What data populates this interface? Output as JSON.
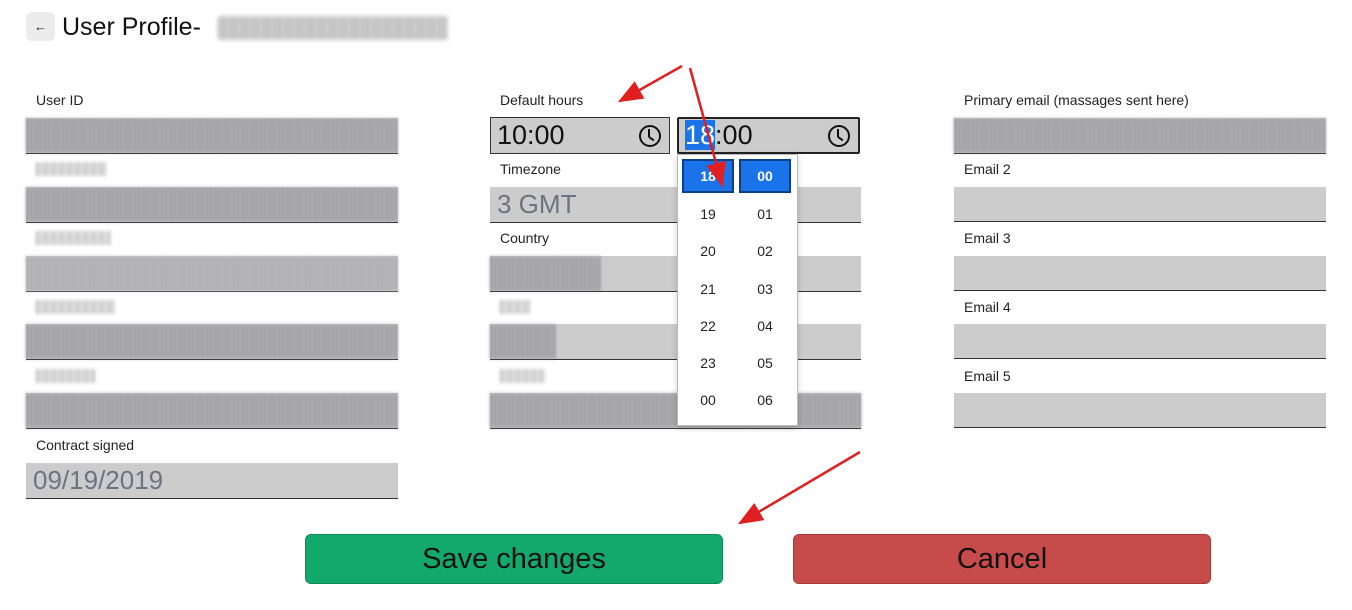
{
  "header": {
    "back_icon": "arrow-left-icon",
    "back_glyph": "←",
    "title": "User Profile-"
  },
  "column1": {
    "user_id_label": "User ID",
    "contract_label": "Contract signed",
    "contract_value": "09/19/2019"
  },
  "column2": {
    "default_hours_label": "Default hours",
    "start_time": "10:00",
    "end_time_hour": "18",
    "end_time_rest": ":00",
    "timezone_label": "Timezone",
    "timezone_value": "3 GMT",
    "country_label": "Country"
  },
  "time_picker": {
    "hours": [
      "18",
      "19",
      "20",
      "21",
      "22",
      "23",
      "00"
    ],
    "minutes": [
      "00",
      "01",
      "02",
      "03",
      "04",
      "05",
      "06"
    ],
    "selected_hour": "18",
    "selected_minute": "00"
  },
  "column3": {
    "primary_email_label": "Primary email (massages sent here)",
    "email2_label": "Email 2",
    "email3_label": "Email 3",
    "email4_label": "Email 4",
    "email5_label": "Email 5"
  },
  "actions": {
    "save_label": "Save changes",
    "cancel_label": "Cancel"
  },
  "colors": {
    "save": "#14a96c",
    "cancel": "#c74b4b",
    "field": "#cccccc",
    "highlight": "#1a73e8",
    "annotation": "#e02020"
  }
}
